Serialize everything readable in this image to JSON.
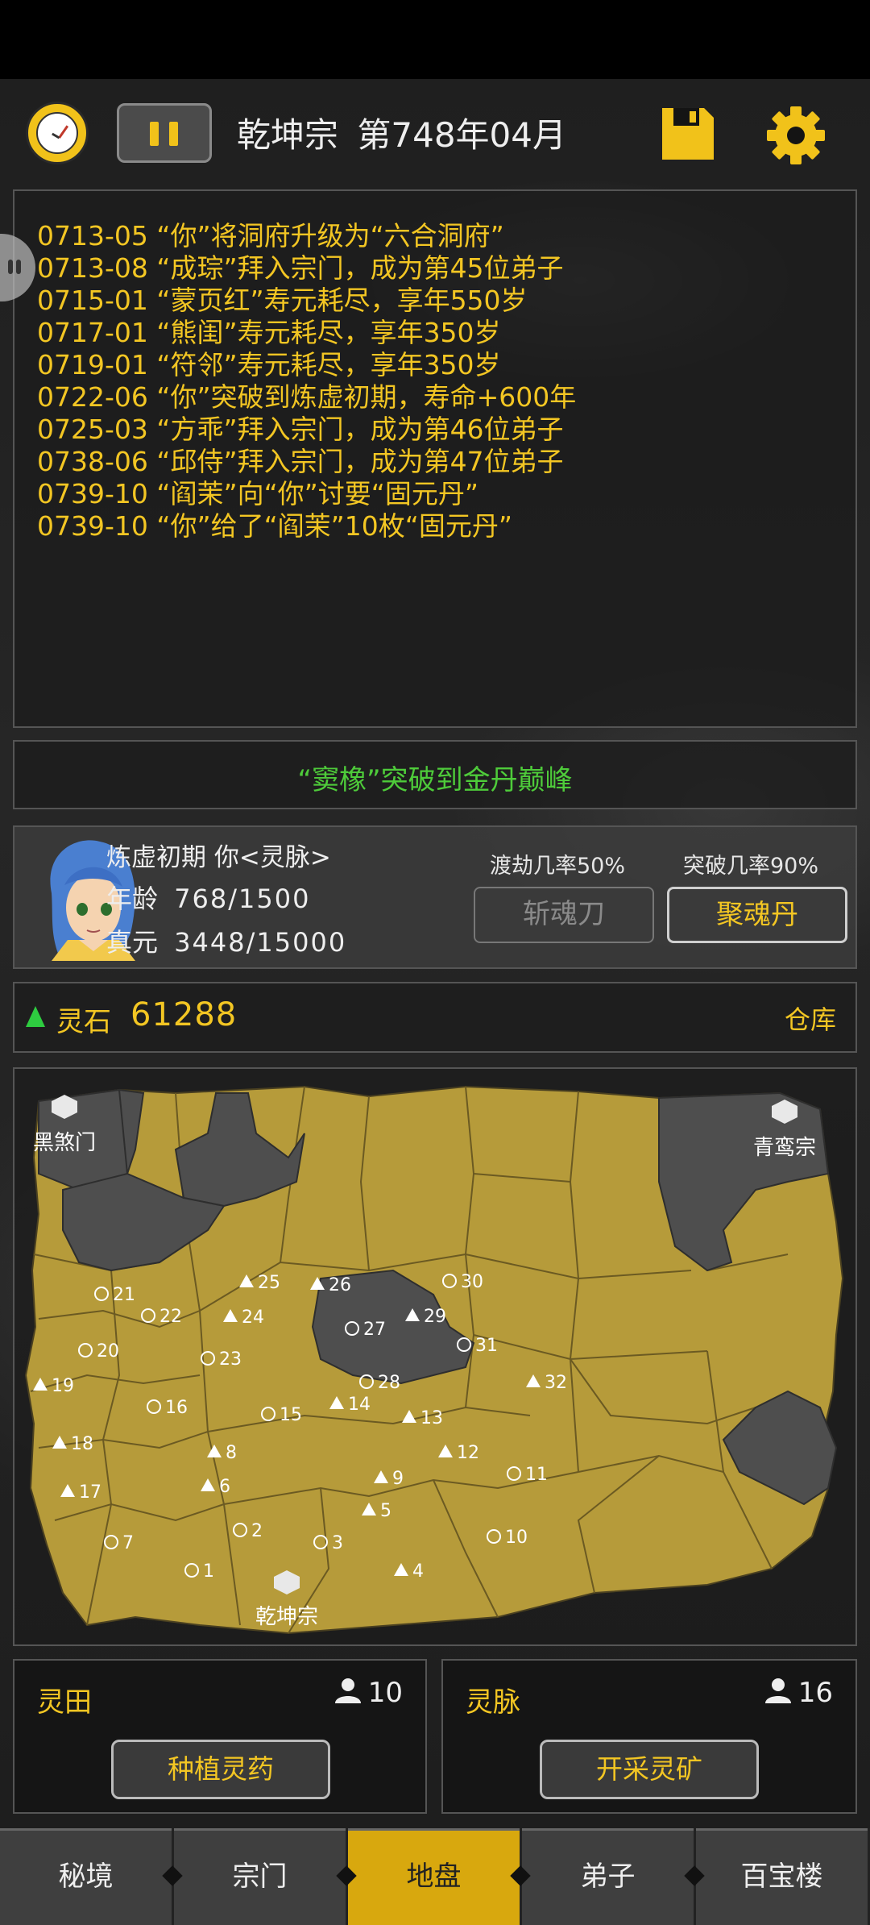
{
  "header": {
    "sect_name": "乾坤宗",
    "date": "第748年04月",
    "clock_icon": "clock-icon",
    "pause_icon": "pause-icon",
    "save_icon": "save-icon",
    "settings_icon": "gear-icon"
  },
  "log": [
    "0713-05 “你”将洞府升级为“六合洞府”",
    "0713-08 “成琮”拜入宗门，成为第45位弟子",
    "0715-01 “蒙页红”寿元耗尽，享年550岁",
    "0717-01 “熊闺”寿元耗尽，享年350岁",
    "0719-01 “符邻”寿元耗尽，享年350岁",
    "0722-06 “你”突破到炼虚初期，寿命+600年",
    "0725-03 “方乖”拜入宗门，成为第46位弟子",
    "0738-06 “邱侍”拜入宗门，成为第47位弟子",
    "0739-10 “阎茉”向“你”讨要“固元丹”",
    "0739-10 “你”给了“阎茉”10枚“固元丹”"
  ],
  "news": "“窦橡”突破到金丹巅峰",
  "player": {
    "realm_name": "炼虚初期 你<灵脉>",
    "age_label": "年龄",
    "age_value": "768/1500",
    "energy_label": "真元",
    "energy_value": "3448/15000",
    "tribulation_rate": "渡劫几率50%",
    "breakthrough_rate": "突破几率90%",
    "btn_sword": "斩魂刀",
    "btn_pill": "聚魂丹"
  },
  "resources": {
    "spirit_stone_label": "灵石",
    "spirit_stone_value": "61288",
    "warehouse": "仓库"
  },
  "map": {
    "sect_home": "乾坤宗",
    "rival_1": "黑煞门",
    "rival_2": "青鸾宗",
    "owned_circles": [
      "1",
      "2",
      "3",
      "7",
      "10",
      "16",
      "23",
      "27",
      "28"
    ],
    "owned_triangles": [
      "4",
      "5",
      "6",
      "8",
      "9",
      "12",
      "13",
      "14",
      "17",
      "18",
      "19",
      "24",
      "25",
      "26",
      "29",
      "32"
    ],
    "enemy_circles": [
      "11",
      "15",
      "20",
      "21",
      "22",
      "30",
      "31"
    ]
  },
  "fields": {
    "title": "灵田",
    "count": "10",
    "button": "种植灵药"
  },
  "veins": {
    "title": "灵脉",
    "count": "16",
    "button": "开采灵矿"
  },
  "tabs": [
    "秘境",
    "宗门",
    "地盘",
    "弟子",
    "百宝楼"
  ],
  "active_tab": "地盘",
  "colors": {
    "accent_yellow": "#f3c623",
    "news_green": "#4ecb3a",
    "owned_territory": "#b69b3a",
    "enemy_territory": "#4e4e4e"
  }
}
